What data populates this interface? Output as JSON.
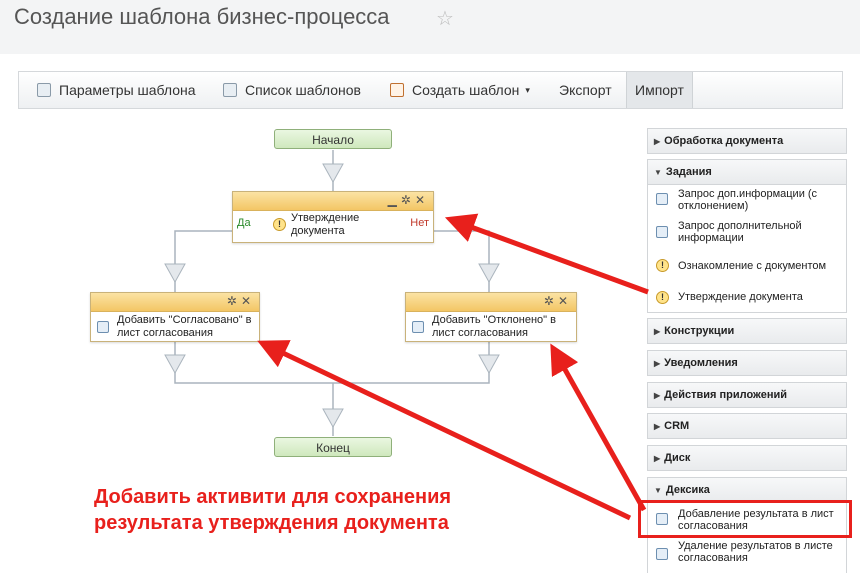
{
  "page": {
    "title": "Создание шаблона бизнес-процесса"
  },
  "toolbar": {
    "items": [
      {
        "label": "Параметры шаблона",
        "icon": "settings-icon"
      },
      {
        "label": "Список шаблонов",
        "icon": "list-icon"
      },
      {
        "label": "Создать шаблон",
        "icon": "new-document-icon"
      },
      {
        "label": "Экспорт"
      },
      {
        "label": "Импорт"
      }
    ]
  },
  "flow": {
    "start": "Начало",
    "end": "Конец",
    "condition": {
      "title": "Утверждение документа",
      "yes": "Да",
      "no": "Нет"
    },
    "left_action": "Добавить \"Согласовано\" в лист согласования",
    "right_action": "Добавить \"Отклонено\" в лист согласования"
  },
  "sidebar": {
    "sections": [
      {
        "label": "Обработка документа",
        "expanded": false
      },
      {
        "label": "Задания",
        "expanded": true,
        "items": [
          "Запрос доп.информации (с отклонением)",
          "Запрос дополнительной информации",
          "Ознакомление с документом",
          "Утверждение документа"
        ]
      },
      {
        "label": "Конструкции",
        "expanded": false
      },
      {
        "label": "Уведомления",
        "expanded": false
      },
      {
        "label": "Действия приложений",
        "expanded": false
      },
      {
        "label": "CRM",
        "expanded": false
      },
      {
        "label": "Диск",
        "expanded": false
      },
      {
        "label": "Дексика",
        "expanded": true,
        "items": [
          "Добавление результата в лист согласования",
          "Удаление результатов в листе согласования"
        ]
      }
    ]
  },
  "annotation": {
    "line1": "Добавить активити для сохранения",
    "line2": "результата утверждения документа",
    "color": "#e8201c"
  },
  "colors": {
    "start_end_fill": "#d9efc9",
    "action_header": "#f5cd70",
    "yes_text": "#2a8a2a",
    "no_text": "#c0392b"
  }
}
